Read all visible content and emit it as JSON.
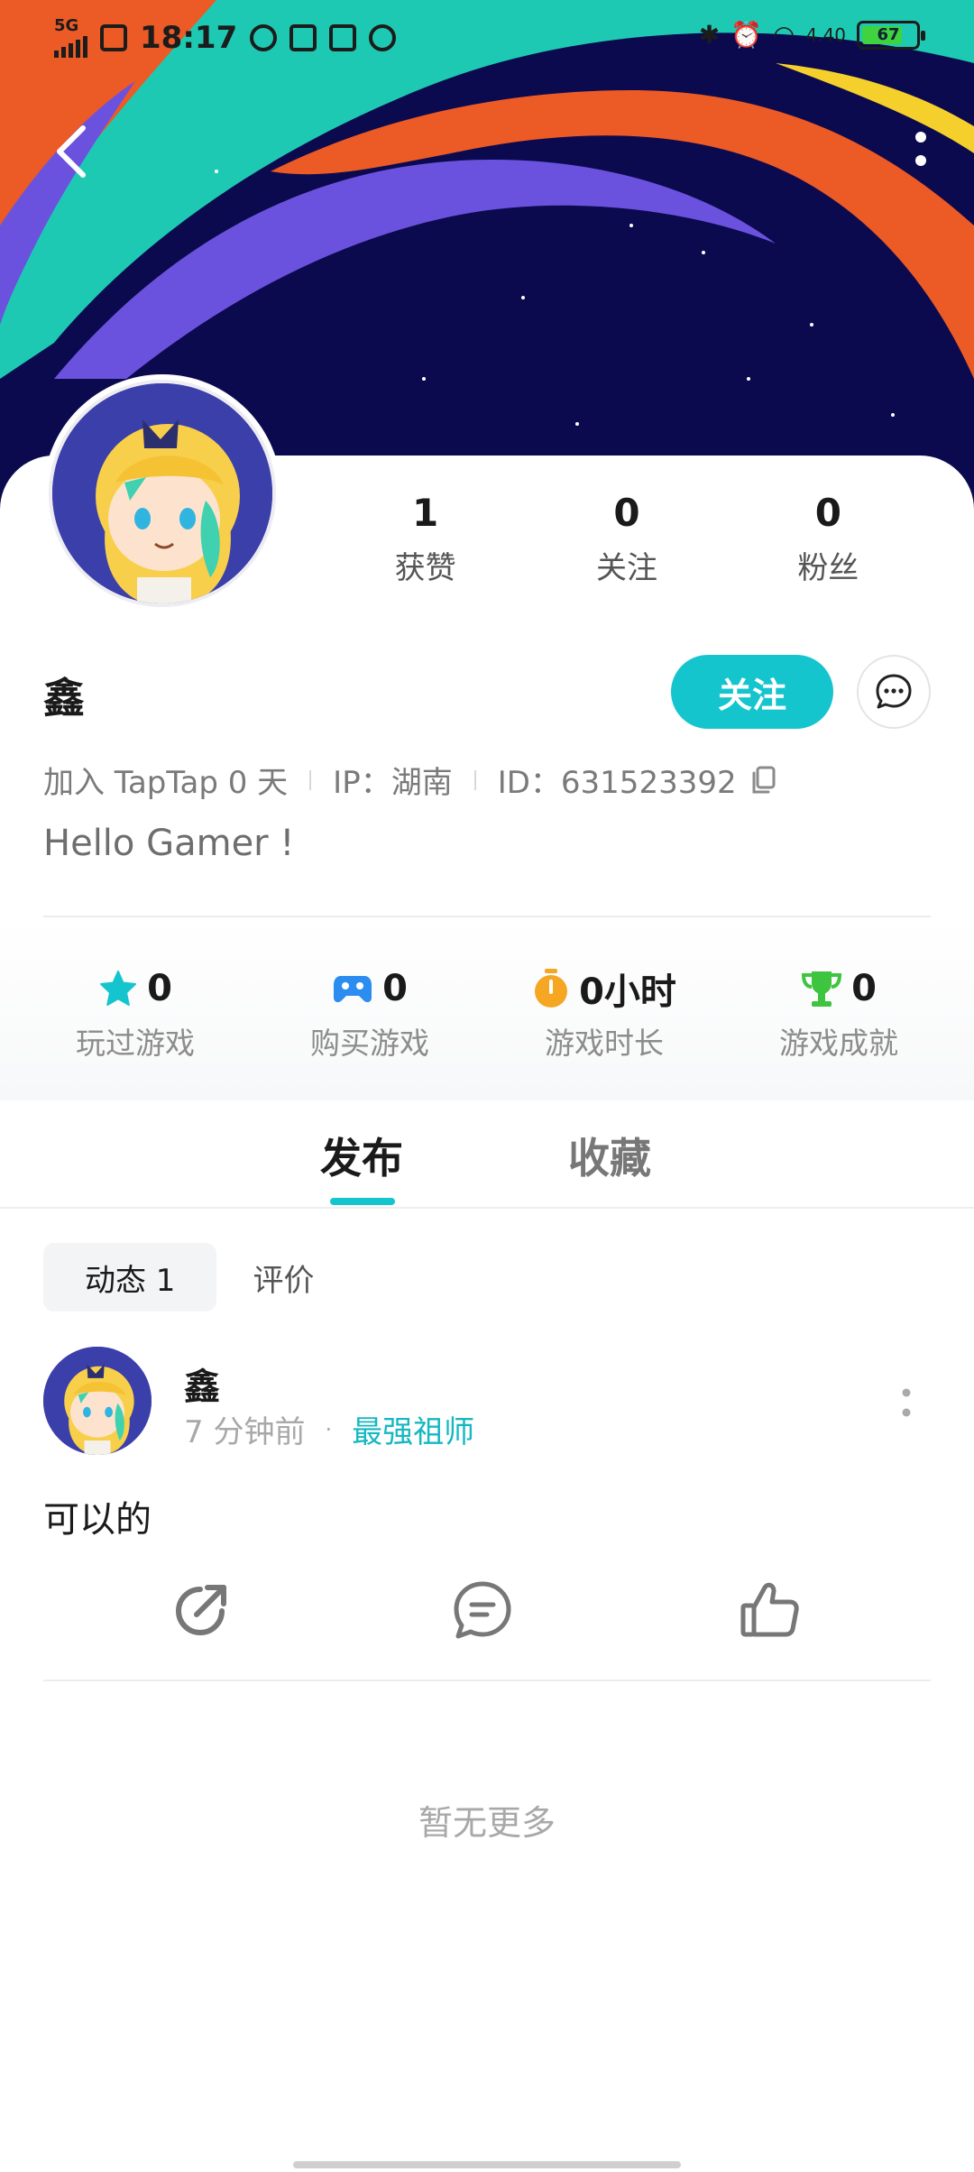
{
  "status_bar": {
    "network": "5G",
    "time": "18:17",
    "speed": "4.40",
    "battery": "67"
  },
  "header": {
    "back_icon": "chevron-left-icon",
    "more_icon": "more-vertical-icon"
  },
  "profile": {
    "username": "鑫",
    "stats": [
      {
        "value": "1",
        "label": "获赞"
      },
      {
        "value": "0",
        "label": "关注"
      },
      {
        "value": "0",
        "label": "粉丝"
      }
    ],
    "follow_label": "关注",
    "joined": "加入 TapTap 0 天",
    "ip": "IP：湖南",
    "id": "ID：631523392",
    "bio": "Hello Gamer !",
    "accent_color": "#15c5ce"
  },
  "game_stats": [
    {
      "icon": "star-icon",
      "value": "0",
      "label": "玩过游戏",
      "color": "#15c5ce"
    },
    {
      "icon": "gamepad-icon",
      "value": "0",
      "label": "购买游戏",
      "color": "#2d8cf0"
    },
    {
      "icon": "timer-icon",
      "value": "0小时",
      "label": "游戏时长",
      "color": "#f5a623"
    },
    {
      "icon": "trophy-icon",
      "value": "0",
      "label": "游戏成就",
      "color": "#3fc43f"
    }
  ],
  "tabs": [
    {
      "label": "发布",
      "active": true
    },
    {
      "label": "收藏",
      "active": false
    }
  ],
  "subtabs": [
    {
      "label": "动态 1",
      "active": true
    },
    {
      "label": "评价",
      "active": false
    }
  ],
  "post": {
    "author": "鑫",
    "time": "7 分钟前",
    "separator": "·",
    "game": "最强祖师",
    "text": "可以的",
    "actions": [
      "share-icon",
      "comment-icon",
      "like-icon"
    ]
  },
  "footer": {
    "no_more": "暂无更多"
  }
}
